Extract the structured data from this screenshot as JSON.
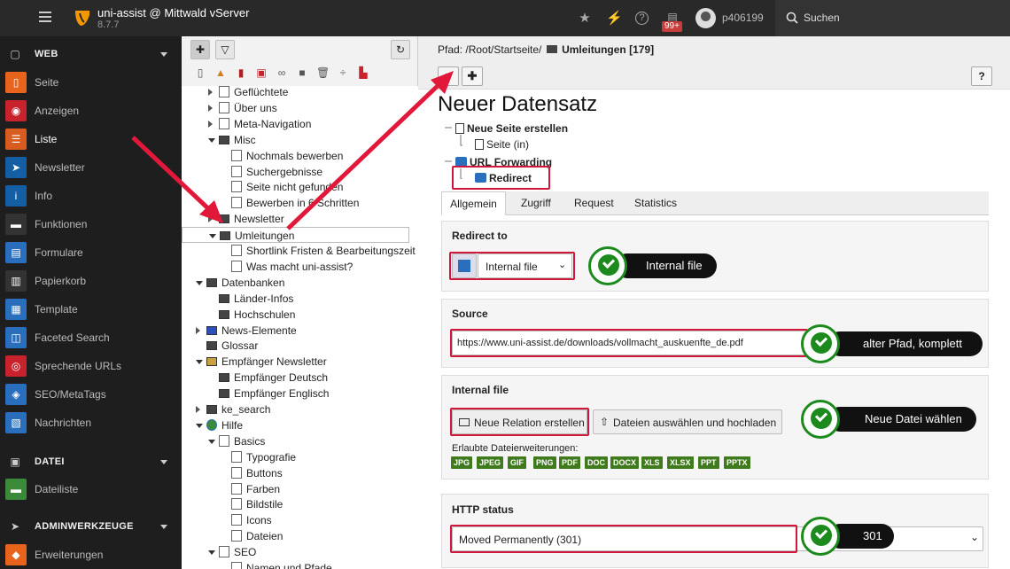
{
  "topbar": {
    "app_title": "uni-assist @ Mittwald vServer",
    "version": "8.7.7",
    "badge": "99+",
    "username": "p406199",
    "search_label": "Suchen"
  },
  "sidebar": {
    "groups": [
      {
        "label": "WEB"
      },
      {
        "label": "DATEI"
      },
      {
        "label": "ADMINWERKZEUGE"
      }
    ],
    "web_items": [
      {
        "label": "Seite",
        "color": "#e8631c"
      },
      {
        "label": "Anzeigen",
        "color": "#c8232c"
      },
      {
        "label": "Liste",
        "color": "#d85c20"
      },
      {
        "label": "Newsletter",
        "color": "#145fa3"
      },
      {
        "label": "Info",
        "color": "#145fa3"
      },
      {
        "label": "Funktionen",
        "color": "#333333"
      },
      {
        "label": "Formulare",
        "color": "#2a6fbe"
      },
      {
        "label": "Papierkorb",
        "color": "#333333"
      },
      {
        "label": "Template",
        "color": "#2a6fbe"
      },
      {
        "label": "Faceted Search",
        "color": "#2a6fbe"
      },
      {
        "label": "Sprechende URLs",
        "color": "#c8232c"
      },
      {
        "label": "SEO/MetaTags",
        "color": "#2a6fbe"
      },
      {
        "label": "Nachrichten",
        "color": "#2a6fbe"
      }
    ],
    "datei_items": [
      {
        "label": "Dateiliste",
        "color": "#3a8a3a"
      }
    ],
    "admin_items": [
      {
        "label": "Erweiterungen",
        "color": "#e8631c"
      }
    ]
  },
  "tree": {
    "rows": [
      {
        "label": "Geflüchtete",
        "depth": 2
      },
      {
        "label": "Über uns",
        "depth": 2
      },
      {
        "label": "Meta-Navigation",
        "depth": 2
      },
      {
        "label": "Misc",
        "depth": 2
      },
      {
        "label": "Nochmals bewerben",
        "depth": 3
      },
      {
        "label": "Suchergebnisse",
        "depth": 3
      },
      {
        "label": "Seite nicht gefunden",
        "depth": 3
      },
      {
        "label": "Bewerben in 6 Schritten",
        "depth": 3
      },
      {
        "label": "Newsletter",
        "depth": 2
      },
      {
        "label": "Umleitungen",
        "depth": 2
      },
      {
        "label": "Shortlink Fristen & Bearbeitungszeit",
        "depth": 3
      },
      {
        "label": "Was macht uni-assist?",
        "depth": 3
      },
      {
        "label": "Datenbanken",
        "depth": 1
      },
      {
        "label": "Länder-Infos",
        "depth": 2
      },
      {
        "label": "Hochschulen",
        "depth": 2
      },
      {
        "label": "News-Elemente",
        "depth": 1
      },
      {
        "label": "Glossar",
        "depth": 1
      },
      {
        "label": "Empfänger Newsletter",
        "depth": 1
      },
      {
        "label": "Empfänger Deutsch",
        "depth": 2
      },
      {
        "label": "Empfänger Englisch",
        "depth": 2
      },
      {
        "label": "ke_search",
        "depth": 1
      },
      {
        "label": "Hilfe",
        "depth": 1
      },
      {
        "label": "Basics",
        "depth": 2
      },
      {
        "label": "Typografie",
        "depth": 3
      },
      {
        "label": "Buttons",
        "depth": 3
      },
      {
        "label": "Farben",
        "depth": 3
      },
      {
        "label": "Bildstile",
        "depth": 3
      },
      {
        "label": "Icons",
        "depth": 3
      },
      {
        "label": "Dateien",
        "depth": 3
      },
      {
        "label": "SEO",
        "depth": 2
      },
      {
        "label": "Namen und Pfade",
        "depth": 3
      }
    ]
  },
  "main": {
    "path_prefix": "Pfad: /Root/Startseite/",
    "path_current": "Umleitungen [179]",
    "help": "?",
    "heading": "Neuer Datensatz",
    "new_page": "Neue Seite erstellen",
    "page_in": "Seite (in)",
    "url_forwarding": "URL Forwarding",
    "redirect": "Redirect",
    "tabs": [
      "Allgemein",
      "Zugriff",
      "Request",
      "Statistics"
    ],
    "redirect_to_label": "Redirect to",
    "redirect_to_value": "Internal file",
    "source_label": "Source",
    "source_value": "https://www.uni-assist.de/downloads/vollmacht_auskuenfte_de.pdf",
    "internal_file_label": "Internal file",
    "new_relation_btn": "Neue Relation erstellen",
    "upload_btn": "Dateien auswählen und hochladen",
    "allowed_ext_label": "Erlaubte Dateierweiterungen:",
    "extensions": [
      "JPG",
      "JPEG",
      "GIF",
      "PNG",
      "PDF",
      "DOC",
      "DOCX",
      "XLS",
      "XLSX",
      "PPT",
      "PPTX"
    ],
    "http_status_label": "HTTP status",
    "http_status_value": "Moved Permanently (301)"
  },
  "callouts": {
    "internal_file": "Internal file",
    "old_path": "alter Pfad, komplett",
    "new_file": "Neue Datei wählen",
    "status": "301"
  },
  "colors": {
    "accent_red": "#d0163a",
    "check_green": "#1c8a1c",
    "ext_green": "#3f7a1c"
  }
}
